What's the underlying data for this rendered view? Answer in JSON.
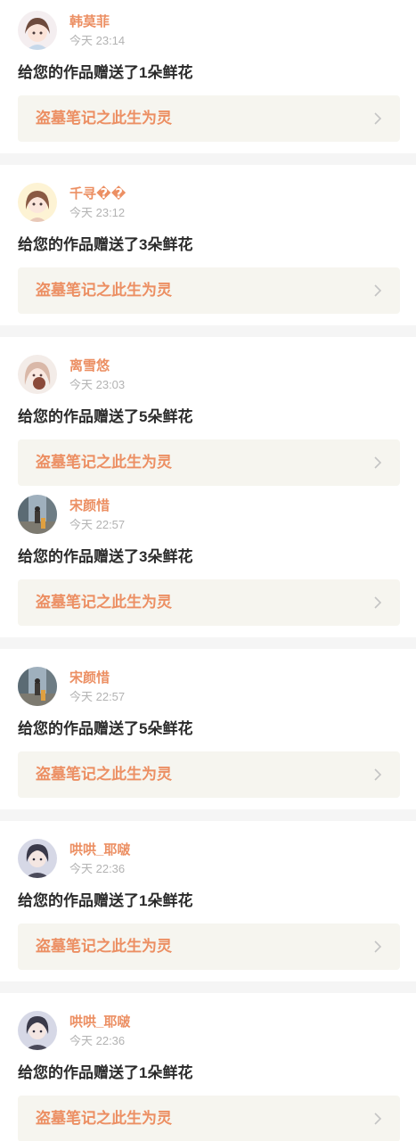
{
  "entries": [
    {
      "username": "韩莫菲",
      "time": "今天 23:14",
      "message": "给您的作品赠送了1朵鲜花",
      "work_title": "盗墓笔记之此生为灵",
      "avatar_icon": "girl-cartoon-avatar"
    },
    {
      "username": "千寻��",
      "time": "今天 23:12",
      "message": "给您的作品赠送了3朵鲜花",
      "work_title": "盗墓笔记之此生为灵",
      "avatar_icon": "girl-cartoon-avatar"
    },
    {
      "username": "离雪悠",
      "time": "今天 23:03",
      "message": "给您的作品赠送了5朵鲜花",
      "work_title": "盗墓笔记之此生为灵",
      "avatar_icon": "girl-anime-avatar"
    },
    {
      "username": "宋颜惜",
      "time": "今天 22:57",
      "message": "给您的作品赠送了3朵鲜花",
      "work_title": "盗墓笔记之此生为灵",
      "avatar_icon": "street-photo-avatar"
    },
    {
      "username": "宋颜惜",
      "time": "今天 22:57",
      "message": "给您的作品赠送了5朵鲜花",
      "work_title": "盗墓笔记之此生为灵",
      "avatar_icon": "street-photo-avatar"
    },
    {
      "username": "哄哄_耶啵",
      "time": "今天 22:36",
      "message": "给您的作品赠送了1朵鲜花",
      "work_title": "盗墓笔记之此生为灵",
      "avatar_icon": "boy-anime-avatar"
    },
    {
      "username": "哄哄_耶啵",
      "time": "今天 22:36",
      "message": "给您的作品赠送了1朵鲜花",
      "work_title": "盗墓笔记之此生为灵",
      "avatar_icon": "boy-anime-avatar"
    }
  ],
  "colors": {
    "accent": "#ec8f63",
    "link_bg": "#f6f5ef",
    "separator": "#f5f5f5"
  }
}
